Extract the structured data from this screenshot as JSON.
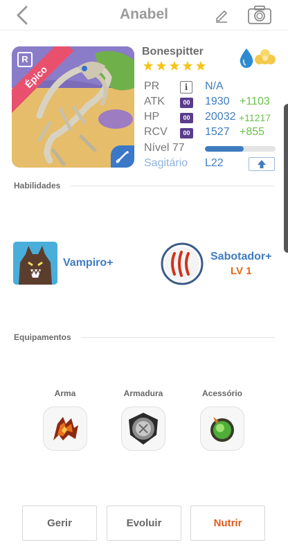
{
  "header": {
    "title": "Anabel"
  },
  "monster": {
    "name": "Bonespitter",
    "stars": 5,
    "rarity_badge": "R",
    "rarity": "Épico",
    "elements": [
      "water-drop-icon",
      "cloud-icon"
    ]
  },
  "stats": {
    "pr": {
      "label": "PR",
      "info": "i",
      "value": "N/A"
    },
    "atk": {
      "label": "ATK",
      "badge": "00",
      "value": "1930",
      "bonus": "+1103"
    },
    "hp": {
      "label": "HP",
      "badge": "00",
      "value": "20032",
      "bonus": "+11217"
    },
    "rcv": {
      "label": "RCV",
      "badge": "00",
      "value": "1527",
      "bonus": "+855"
    },
    "level": {
      "label": "Nível 77",
      "progress": 0.55
    },
    "sign": {
      "label": "Sagitário",
      "value": "L22"
    }
  },
  "skills": {
    "section_label": "Habilidades",
    "items": [
      {
        "name": "Vampiro+"
      },
      {
        "name": "Sabotador+",
        "level": "LV 1"
      }
    ]
  },
  "equipment": {
    "section_label": "Equipamentos",
    "slots": [
      {
        "label": "Arma"
      },
      {
        "label": "Armadura"
      },
      {
        "label": "Acessório"
      }
    ]
  },
  "actions": {
    "manage": "Gerir",
    "evolve": "Evoluir",
    "feed": "Nutrir"
  },
  "colors": {
    "accent_blue": "#3f7cc0",
    "bonus_green": "#6ac14a",
    "feed_orange": "#e05a1e",
    "star_yellow": "#f5c518",
    "epic_pink": "#e8506d"
  }
}
